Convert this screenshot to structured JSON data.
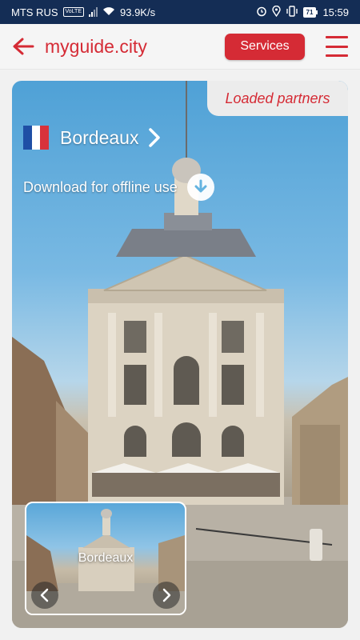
{
  "status_bar": {
    "carrier": "MTS RUS",
    "network_badge": "VoLTE",
    "speed": "93.9K/s",
    "battery": "71",
    "time": "15:59",
    "icons": [
      "signal-icon",
      "wifi-icon",
      "alarm-icon",
      "location-icon",
      "vibrate-icon",
      "battery-icon"
    ]
  },
  "app_bar": {
    "back_icon": "arrow-left-icon",
    "brand": "myguide.city",
    "services_label": "Services",
    "menu_icon": "hamburger-menu-icon"
  },
  "card": {
    "partners_label": "Loaded partners",
    "city": "Bordeaux",
    "flag_colors": [
      "#1f4fa5",
      "#ffffff",
      "#d8323b"
    ],
    "download_label": "Download for offline use",
    "thumbnail": {
      "label": "Bordeaux"
    }
  },
  "colors": {
    "accent": "#d52b35",
    "status_bar": "#142d55"
  }
}
